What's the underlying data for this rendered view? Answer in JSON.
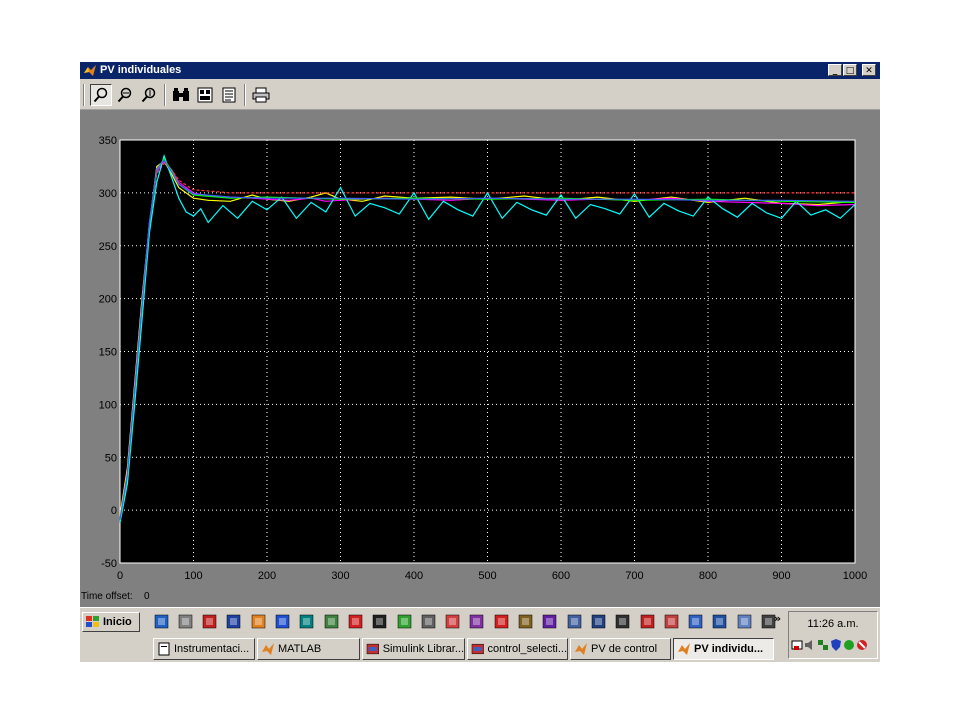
{
  "window": {
    "title": "PV individuales",
    "minimize_label": "_",
    "maximize_label": "□",
    "close_label": "✕"
  },
  "toolbar": {
    "buttons": [
      "zoom-icon",
      "zoom-x-icon",
      "zoom-y-icon",
      "autoscale-icon",
      "save-axes-icon",
      "parameters-icon",
      "print-icon"
    ]
  },
  "time_offset": {
    "label": "Time offset:",
    "value": "0"
  },
  "chart_data": {
    "type": "line",
    "title": "",
    "xlabel": "",
    "ylabel": "",
    "xlim": [
      0,
      1000
    ],
    "ylim": [
      -50,
      350
    ],
    "xticks": [
      0,
      100,
      200,
      300,
      400,
      500,
      600,
      700,
      800,
      900,
      1000
    ],
    "yticks": [
      -50,
      0,
      50,
      100,
      150,
      200,
      250,
      300,
      350
    ],
    "grid": true,
    "background": "#000000",
    "series": [
      {
        "color": "#ffff00",
        "x": [
          0,
          10,
          20,
          30,
          40,
          50,
          60,
          70,
          80,
          100,
          120,
          150,
          180,
          200,
          230,
          260,
          280,
          300,
          330,
          360,
          400,
          450,
          500,
          550,
          600,
          650,
          700,
          750,
          800,
          850,
          900,
          950,
          1000
        ],
        "y": [
          -5,
          40,
          120,
          200,
          270,
          325,
          330,
          318,
          305,
          295,
          293,
          292,
          298,
          294,
          292,
          296,
          300,
          294,
          292,
          297,
          295,
          296,
          294,
          297,
          293,
          296,
          292,
          296,
          291,
          295,
          290,
          289,
          292
        ]
      },
      {
        "color": "#ff00ff",
        "x": [
          0,
          10,
          20,
          30,
          40,
          50,
          60,
          70,
          80,
          100,
          120,
          150,
          180,
          200,
          230,
          260,
          280,
          300,
          330,
          360,
          400,
          450,
          500,
          550,
          600,
          650,
          700,
          750,
          800,
          850,
          900,
          950,
          1000
        ],
        "y": [
          -8,
          35,
          115,
          195,
          272,
          320,
          330,
          322,
          310,
          300,
          297,
          296,
          295,
          294,
          293,
          295,
          292,
          293,
          294,
          295,
          294,
          293,
          295,
          294,
          293,
          294,
          293,
          295,
          292,
          291,
          290,
          288,
          289
        ]
      },
      {
        "color": "#ff3030",
        "dashed": true,
        "x": [
          0,
          10,
          20,
          30,
          40,
          50,
          60,
          70,
          80,
          100,
          150,
          200,
          300,
          400,
          500,
          600,
          700,
          800,
          900,
          1000
        ],
        "y": [
          -10,
          30,
          110,
          190,
          268,
          318,
          328,
          322,
          312,
          303,
          300,
          300,
          300,
          300,
          300,
          300,
          300,
          300,
          300,
          300
        ]
      },
      {
        "color": "#00ffff",
        "x": [
          0,
          10,
          20,
          30,
          40,
          50,
          60,
          70,
          80,
          90,
          100,
          110,
          120,
          140,
          160,
          180,
          200,
          220,
          240,
          260,
          280,
          300,
          320,
          340,
          360,
          380,
          400,
          420,
          440,
          460,
          480,
          500,
          520,
          540,
          560,
          580,
          600,
          620,
          640,
          660,
          680,
          700,
          720,
          740,
          760,
          780,
          800,
          820,
          840,
          860,
          880,
          900,
          920,
          940,
          960,
          980,
          1000
        ],
        "y": [
          -12,
          25,
          100,
          180,
          262,
          310,
          335,
          315,
          295,
          282,
          278,
          285,
          272,
          288,
          276,
          292,
          284,
          296,
          276,
          291,
          282,
          305,
          278,
          290,
          286,
          280,
          300,
          275,
          292,
          284,
          278,
          300,
          276,
          291,
          284,
          279,
          298,
          276,
          289,
          285,
          280,
          299,
          277,
          290,
          283,
          278,
          296,
          285,
          277,
          290,
          281,
          276,
          292,
          279,
          284,
          276,
          289
        ]
      },
      {
        "color": "#00ff00",
        "x": [
          0,
          10,
          20,
          30,
          40,
          50,
          60,
          70,
          80,
          100,
          150,
          200,
          300,
          400,
          500,
          600,
          700,
          800,
          900,
          1000
        ],
        "y": [
          -9,
          33,
          112,
          192,
          270,
          322,
          332,
          321,
          308,
          298,
          295,
          296,
          294,
          295,
          294,
          295,
          293,
          294,
          292,
          291
        ]
      },
      {
        "color": "#4060ff",
        "x": [
          0,
          10,
          20,
          30,
          40,
          50,
          60,
          70,
          80,
          100,
          150,
          200,
          300,
          400,
          500,
          600,
          700,
          800,
          900,
          1000
        ],
        "y": [
          -9,
          34,
          113,
          193,
          271,
          323,
          331,
          320,
          308,
          299,
          296,
          295,
          295,
          294,
          295,
          294,
          294,
          293,
          293,
          292
        ]
      }
    ]
  },
  "taskbar": {
    "start_label": "Inicio",
    "quicklaunch": [
      "show-desktop-icon",
      "notepad-icon",
      "paint-icon",
      "calc-icon",
      "matlab-icon",
      "app-icon",
      "network-icon",
      "app-icon",
      "ie-icon",
      "3d-icon",
      "app-icon",
      "app-icon",
      "app-icon",
      "app-icon",
      "acrobat-icon",
      "app-icon",
      "app-icon",
      "app-icon",
      "app-icon",
      "app-icon",
      "app-icon",
      "app-icon",
      "app-icon",
      "app-icon",
      "app-icon",
      "max-icon"
    ],
    "more_label": "»",
    "tasks": [
      {
        "label": "Instrumentaci...",
        "icon": "document-icon",
        "active": false
      },
      {
        "label": "MATLAB",
        "icon": "matlab-icon",
        "active": false
      },
      {
        "label": "Simulink Librar...",
        "icon": "simulink-icon",
        "active": false
      },
      {
        "label": "control_selecti...",
        "icon": "simulink-icon",
        "active": false
      },
      {
        "label": "PV de control",
        "icon": "matlab-icon",
        "active": false
      },
      {
        "label": "PV individu...",
        "icon": "matlab-icon",
        "active": true
      }
    ],
    "clock": "11:26 a.m."
  }
}
